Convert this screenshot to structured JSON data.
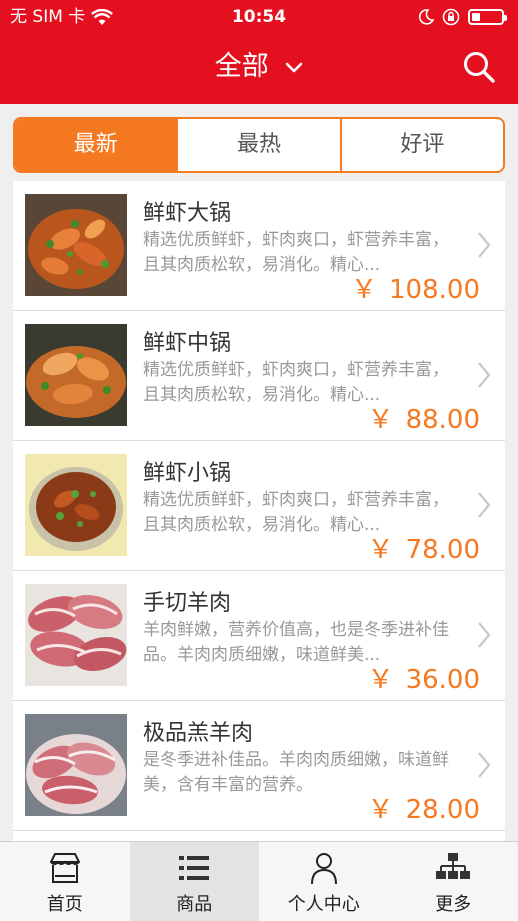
{
  "status": {
    "carrier": "无 SIM 卡",
    "time": "10:54",
    "battery_level": 0.3
  },
  "nav": {
    "title": "全部"
  },
  "colors": {
    "brand_red": "#e4101f",
    "accent_orange": "#f47920"
  },
  "tabs": [
    {
      "label": "最新",
      "active": true
    },
    {
      "label": "最热",
      "active": false
    },
    {
      "label": "好评",
      "active": false
    }
  ],
  "items": [
    {
      "name": "鲜虾大锅",
      "desc": "精选优质鲜虾，虾肉爽口，虾营养丰富，且其肉质松软，易消化。精心...",
      "currency": "￥",
      "price": "108.00",
      "image": "shrimp-pot-image"
    },
    {
      "name": "鲜虾中锅",
      "desc": "精选优质鲜虾，虾肉爽口，虾营养丰富，且其肉质松软，易消化。精心...",
      "currency": "￥",
      "price": "88.00",
      "image": "shrimp-pot-image"
    },
    {
      "name": "鲜虾小锅",
      "desc": "精选优质鲜虾，虾肉爽口，虾营养丰富，且其肉质松软，易消化。精心...",
      "currency": "￥",
      "price": "78.00",
      "image": "shrimp-pot-image"
    },
    {
      "name": "手切羊肉",
      "desc": "羊肉鲜嫩，营养价值高，也是冬季进补佳品。羊肉肉质细嫩，味道鲜美...",
      "currency": "￥",
      "price": "36.00",
      "image": "lamb-slices-image"
    },
    {
      "name": "极品羔羊肉",
      "desc": "是冬季进补佳品。羊肉肉质细嫩，味道鲜美，含有丰富的营养。",
      "currency": "￥",
      "price": "28.00",
      "image": "lamb-slices-image"
    }
  ],
  "tabbar": [
    {
      "label": "首页",
      "icon": "store-icon",
      "active": false
    },
    {
      "label": "商品",
      "icon": "list-icon",
      "active": true
    },
    {
      "label": "个人中心",
      "icon": "person-icon",
      "active": false
    },
    {
      "label": "更多",
      "icon": "sitemap-icon",
      "active": false
    }
  ]
}
